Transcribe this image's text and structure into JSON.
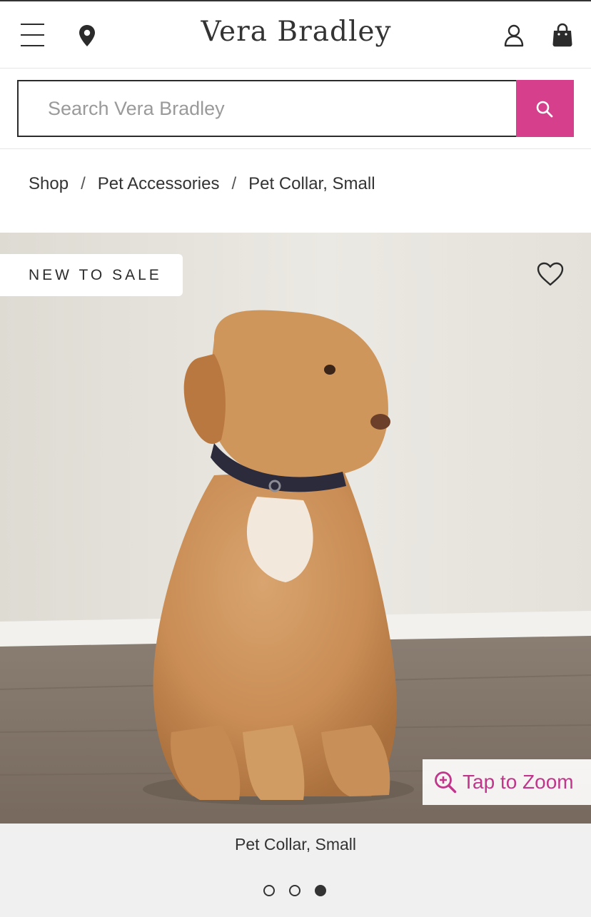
{
  "header": {
    "logo_text": "Vera Bradley",
    "icons": [
      "hamburger-menu-icon",
      "location-pin-icon",
      "account-icon",
      "shopping-bag-icon"
    ]
  },
  "search": {
    "placeholder": "Search Vera Bradley",
    "value": "",
    "button_color": "#d53f8c"
  },
  "breadcrumb": {
    "items": [
      {
        "label": "Shop"
      },
      {
        "label": "Pet Accessories"
      },
      {
        "label": "Pet Collar, Small"
      }
    ],
    "separator": "/"
  },
  "product": {
    "badge": "NEW TO SALE",
    "zoom_label": "Tap to Zoom",
    "image_caption": "Pet Collar, Small",
    "carousel": {
      "total": 3,
      "active_index": 3
    },
    "accent_color": "#c0368a"
  }
}
